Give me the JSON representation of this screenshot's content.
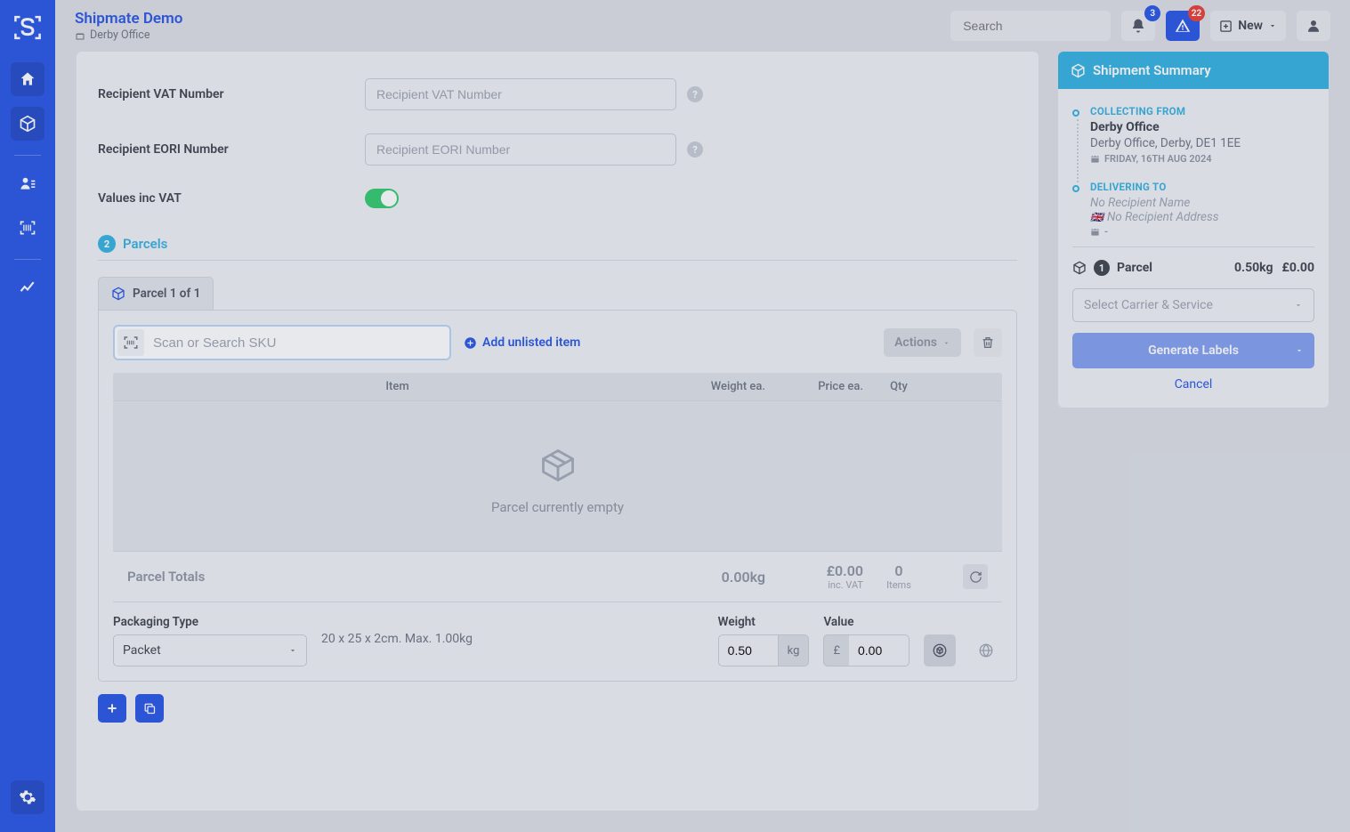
{
  "header": {
    "title": "Shipmate Demo",
    "subtitle": "Derby Office",
    "search_placeholder": "Search",
    "search_shortcut": "/",
    "notification_count": "3",
    "alert_count": "22",
    "new_label": "New"
  },
  "form": {
    "vat_label": "Recipient VAT Number",
    "vat_placeholder": "Recipient VAT Number",
    "eori_label": "Recipient EORI Number",
    "eori_placeholder": "Recipient EORI Number",
    "inc_vat_label": "Values inc VAT"
  },
  "parcels": {
    "section_num": "2",
    "section_title": "Parcels",
    "tab_label": "Parcel 1 of 1",
    "sku_placeholder": "Scan or Search SKU",
    "add_unlisted": "Add unlisted item",
    "actions_label": "Actions",
    "cols": {
      "item": "Item",
      "weight": "Weight ea.",
      "price": "Price ea.",
      "qty": "Qty"
    },
    "empty_text": "Parcel currently empty",
    "totals": {
      "label": "Parcel Totals",
      "weight": "0.00kg",
      "price": "£0.00",
      "price_sub": "inc. VAT",
      "qty": "0",
      "qty_sub": "Items"
    },
    "packaging": {
      "type_label": "Packaging Type",
      "type_value": "Packet",
      "dims": "20 x 25 x 2cm. Max. 1.00kg",
      "weight_label": "Weight",
      "weight_value": "0.50",
      "weight_unit": "kg",
      "value_label": "Value",
      "value_currency": "£",
      "value_amount": "0.00"
    }
  },
  "summary": {
    "title": "Shipment Summary",
    "collecting_label": "COLLECTING FROM",
    "collecting_title": "Derby Office",
    "collecting_address": "Derby Office, Derby, DE1 1EE",
    "collecting_date": "FRIDAY, 16TH AUG 2024",
    "delivering_label": "DELIVERING TO",
    "delivering_name": "No Recipient Name",
    "delivering_address": "No Recipient Address",
    "delivering_date": "-",
    "parcel_count": "1",
    "parcel_label": "Parcel",
    "parcel_weight": "0.50kg",
    "parcel_value": "£0.00",
    "carrier_placeholder": "Select Carrier & Service",
    "generate_label": "Generate Labels",
    "cancel": "Cancel"
  }
}
